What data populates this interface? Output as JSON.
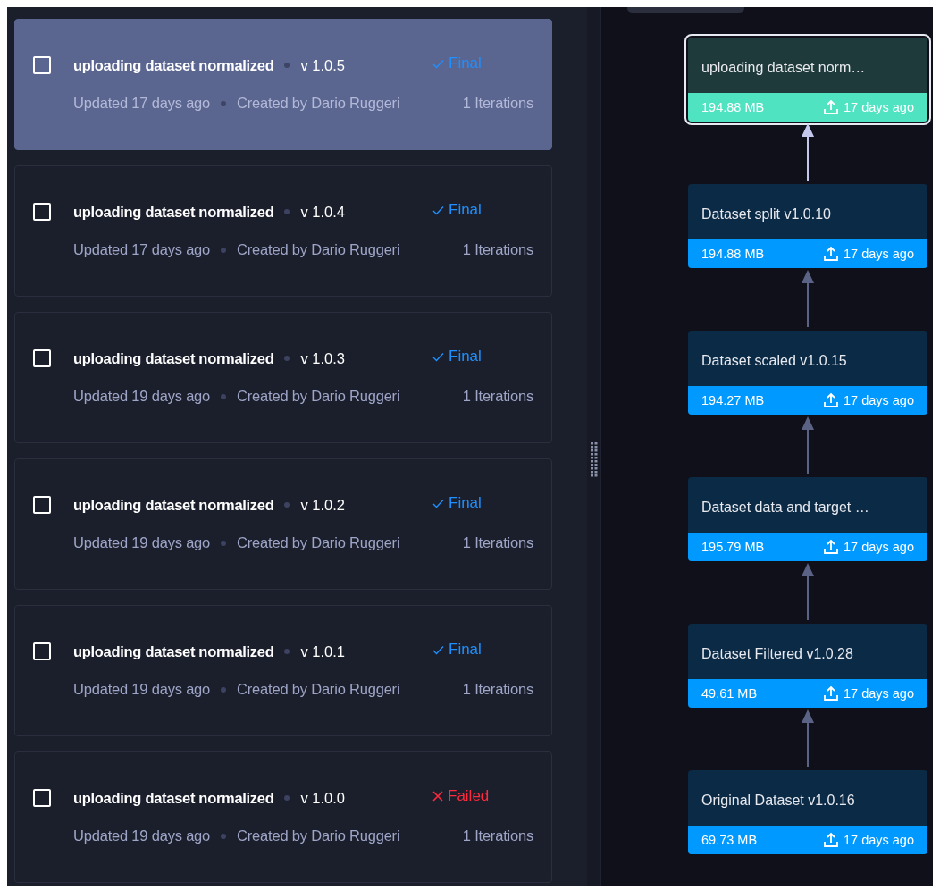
{
  "versions": [
    {
      "title": "uploading dataset normalized",
      "version": "v 1.0.5",
      "status": {
        "kind": "final",
        "label": "Final"
      },
      "updated": "Updated 17 days ago",
      "creator": "Created by Dario Ruggeri",
      "iterations": "1 Iterations",
      "selected": true,
      "checked": false
    },
    {
      "title": "uploading dataset normalized",
      "version": "v 1.0.4",
      "status": {
        "kind": "final",
        "label": "Final"
      },
      "updated": "Updated 17 days ago",
      "creator": "Created by Dario Ruggeri",
      "iterations": "1 Iterations",
      "selected": false,
      "checked": false
    },
    {
      "title": "uploading dataset normalized",
      "version": "v 1.0.3",
      "status": {
        "kind": "final",
        "label": "Final"
      },
      "updated": "Updated 19 days ago",
      "creator": "Created by Dario Ruggeri",
      "iterations": "1 Iterations",
      "selected": false,
      "checked": false
    },
    {
      "title": "uploading dataset normalized",
      "version": "v 1.0.2",
      "status": {
        "kind": "final",
        "label": "Final"
      },
      "updated": "Updated 19 days ago",
      "creator": "Created by Dario Ruggeri",
      "iterations": "1 Iterations",
      "selected": false,
      "checked": false
    },
    {
      "title": "uploading dataset normalized",
      "version": "v 1.0.1",
      "status": {
        "kind": "final",
        "label": "Final"
      },
      "updated": "Updated 19 days ago",
      "creator": "Created by Dario Ruggeri",
      "iterations": "1 Iterations",
      "selected": false,
      "checked": false
    },
    {
      "title": "uploading dataset normalized",
      "version": "v 1.0.0",
      "status": {
        "kind": "failed",
        "label": "Failed"
      },
      "updated": "Updated 19 days ago",
      "creator": "Created by Dario Ruggeri",
      "iterations": "1 Iterations",
      "selected": false,
      "checked": false
    }
  ],
  "lineage": [
    {
      "title": "uploading dataset norm…",
      "size": "194.88 MB",
      "time": "17 days ago",
      "selected": true
    },
    {
      "title": "Dataset split v1.0.10",
      "size": "194.88 MB",
      "time": "17 days ago",
      "selected": false
    },
    {
      "title": "Dataset scaled v1.0.15",
      "size": "194.27 MB",
      "time": "17 days ago",
      "selected": false
    },
    {
      "title": "Dataset data and target …",
      "size": "195.79 MB",
      "time": "17 days ago",
      "selected": false
    },
    {
      "title": "Dataset Filtered v1.0.28",
      "size": "49.61 MB",
      "time": "17 days ago",
      "selected": false
    },
    {
      "title": "Original Dataset v1.0.16",
      "size": "69.73 MB",
      "time": "17 days ago",
      "selected": false
    }
  ]
}
